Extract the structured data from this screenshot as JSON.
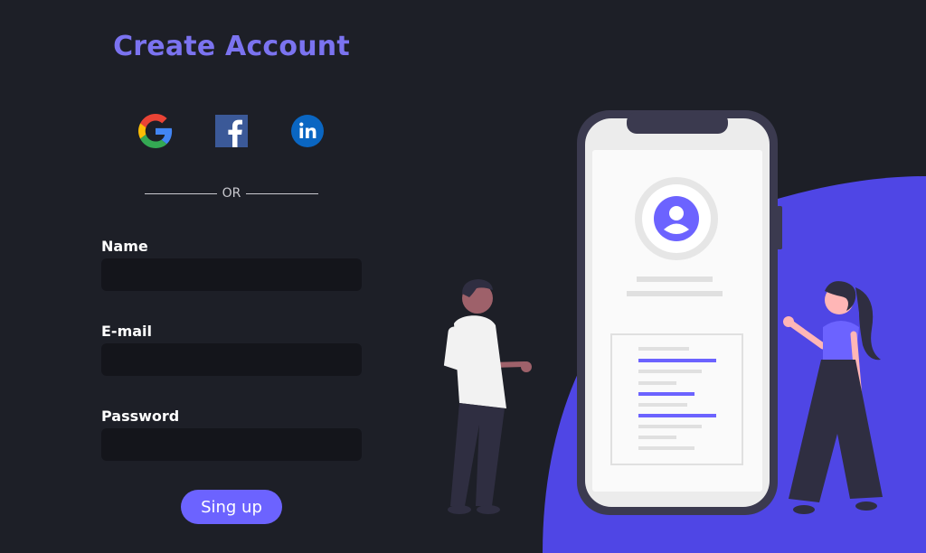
{
  "form": {
    "title": "Create Account",
    "divider_text": "OR",
    "fields": [
      {
        "label": "Name",
        "value": "",
        "placeholder": ""
      },
      {
        "label": "E-mail",
        "value": "",
        "placeholder": ""
      },
      {
        "label": "Password",
        "value": "",
        "placeholder": ""
      }
    ],
    "submit_label": "Sing up"
  },
  "social": [
    {
      "icon": "google-icon"
    },
    {
      "icon": "facebook-icon"
    },
    {
      "icon": "linkedin-icon"
    }
  ],
  "colors": {
    "background": "#1d1f27",
    "accent": "#6c63ff",
    "title": "#7b73f0",
    "input_bg": "#14151b",
    "illustration_blob": "#4f46e5"
  }
}
